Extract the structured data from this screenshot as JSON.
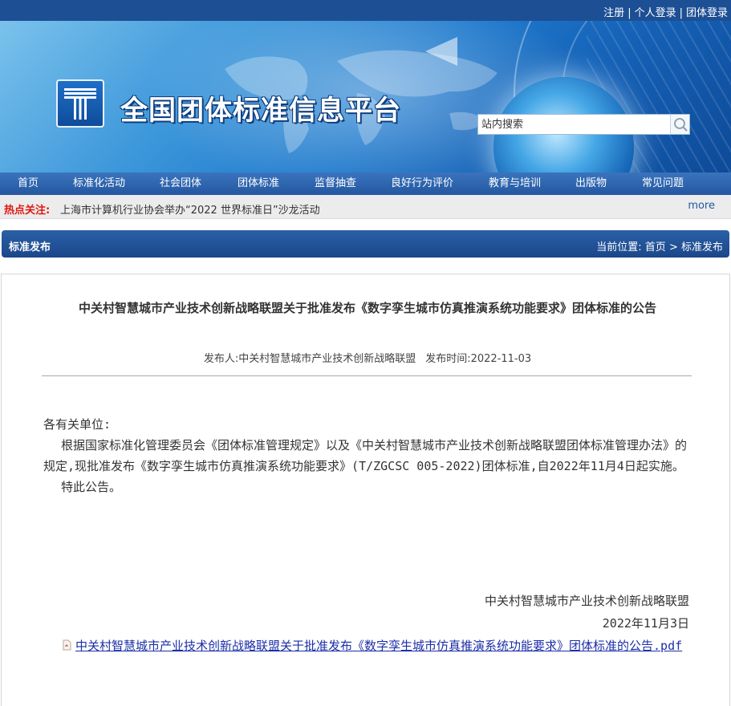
{
  "top_links": {
    "register": "注册",
    "personal_login": "个人登录",
    "group_login": "团体登录",
    "separator": "|"
  },
  "site": {
    "title": "全国团体标准信息平台"
  },
  "search": {
    "placeholder": "站内搜索"
  },
  "nav": {
    "items": [
      {
        "label": "首页"
      },
      {
        "label": "标准化活动"
      },
      {
        "label": "社会团体"
      },
      {
        "label": "团体标准"
      },
      {
        "label": "监督抽查"
      },
      {
        "label": "良好行为评价"
      },
      {
        "label": "教育与培训"
      },
      {
        "label": "出版物"
      },
      {
        "label": "常见问题"
      }
    ]
  },
  "hot": {
    "label": "热点关注:",
    "news": "上海市计算机行业协会举办“2022 世界标准日”沙龙活动",
    "more": "more"
  },
  "section": {
    "title": "标准发布",
    "breadcrumb_prefix": "当前位置:",
    "breadcrumb_home": "首页",
    "breadcrumb_sep": ">",
    "breadcrumb_current": "标准发布"
  },
  "article": {
    "title": "中关村智慧城市产业技术创新战略联盟关于批准发布《数字孪生城市仿真推演系统功能要求》团体标准的公告",
    "publisher_label": "发布人:",
    "publisher": "中关村智慧城市产业技术创新战略联盟",
    "date_label": "发布时间:",
    "date": "2022-11-03",
    "salutation": "各有关单位:",
    "paragraph": "根据国家标准化管理委员会《团体标准管理规定》以及《中关村智慧城市产业技术创新战略联盟团体标准管理办法》的规定,现批准发布《数字孪生城市仿真推演系统功能要求》(T/ZGCSC 005-2022)团体标准,自2022年11月4日起实施。",
    "closing": "特此公告。",
    "signature_org": "中关村智慧城市产业技术创新战略联盟",
    "signature_date": "2022年11月3日",
    "attachment": "中关村智慧城市产业技术创新战略联盟关于批准发布《数字孪生城市仿真推演系统功能要求》团体标准的公告.pdf",
    "attachment_icon": "pdf-file-icon"
  },
  "colors": {
    "top_bar": "#1d4f94",
    "nav": "#2a61a8",
    "hot_label": "#e0160f",
    "link": "#1b2ea8"
  }
}
